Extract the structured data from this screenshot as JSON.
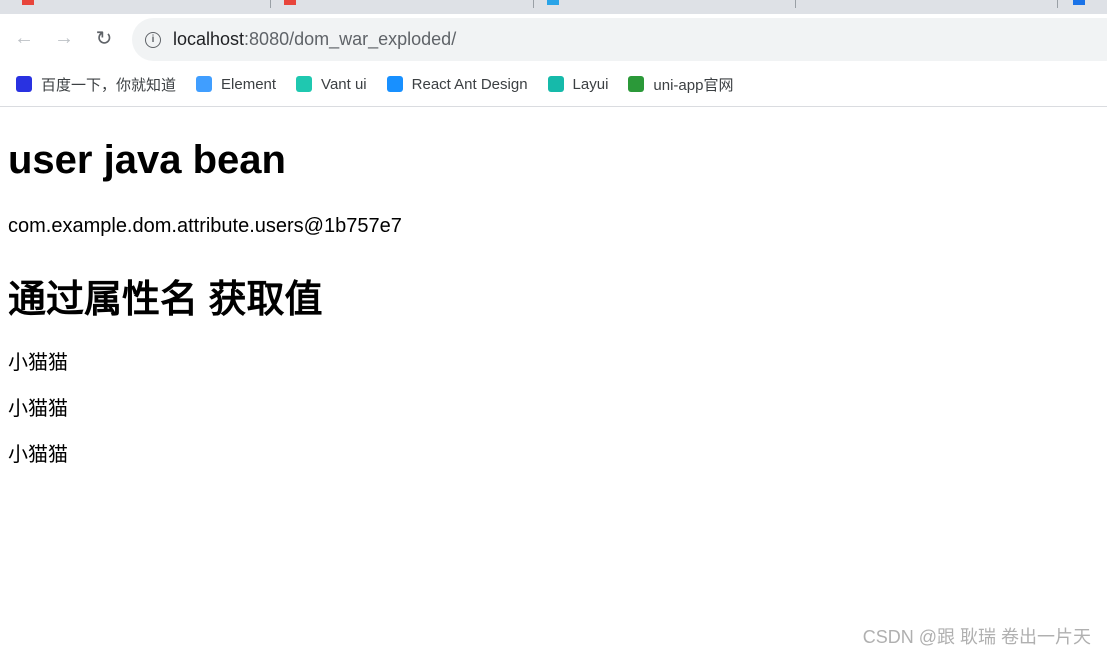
{
  "browser": {
    "url_host": "localhost",
    "url_rest": ":8080/dom_war_exploded/",
    "bookmarks": [
      {
        "label": "百度一下，你就知道",
        "icon": "baidu-icon",
        "color": "#2932e1"
      },
      {
        "label": "Element",
        "icon": "element-icon",
        "color": "#409eff"
      },
      {
        "label": "Vant ui",
        "icon": "vant-icon",
        "color": "#1fc8b0"
      },
      {
        "label": "React Ant Design",
        "icon": "antd-icon",
        "color": "#1890ff"
      },
      {
        "label": "Layui",
        "icon": "layui-icon",
        "color": "#16baaa"
      },
      {
        "label": "uni-app官网",
        "icon": "uniapp-icon",
        "color": "#2b9939"
      }
    ]
  },
  "page": {
    "h1": "user java bean",
    "object": "com.example.dom.attribute.users@1b757e7",
    "h2": "通过属性名 获取值",
    "values": [
      "小猫猫",
      "小猫猫",
      "小猫猫"
    ]
  },
  "watermark": "CSDN @跟 耿瑞 卷出一片天"
}
